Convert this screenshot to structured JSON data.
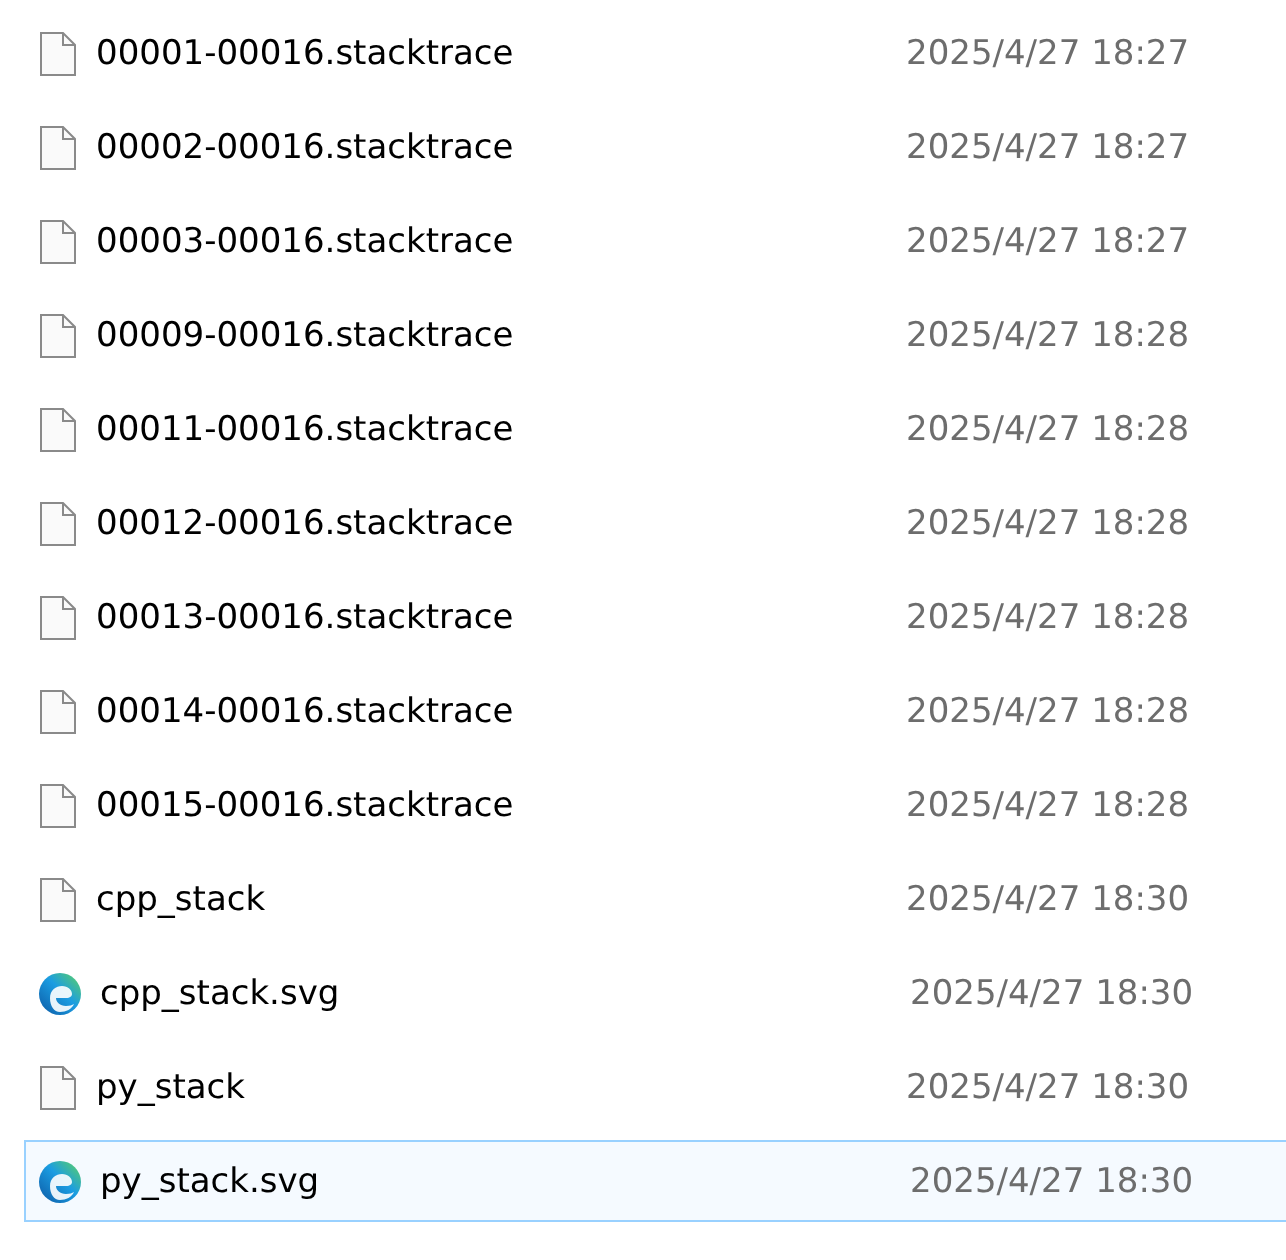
{
  "files": [
    {
      "name": "00001-00016.stacktrace",
      "date": "2025/4/27 18:27",
      "kind": "file",
      "selected": false
    },
    {
      "name": "00002-00016.stacktrace",
      "date": "2025/4/27 18:27",
      "kind": "file",
      "selected": false
    },
    {
      "name": "00003-00016.stacktrace",
      "date": "2025/4/27 18:27",
      "kind": "file",
      "selected": false
    },
    {
      "name": "00009-00016.stacktrace",
      "date": "2025/4/27 18:28",
      "kind": "file",
      "selected": false
    },
    {
      "name": "00011-00016.stacktrace",
      "date": "2025/4/27 18:28",
      "kind": "file",
      "selected": false
    },
    {
      "name": "00012-00016.stacktrace",
      "date": "2025/4/27 18:28",
      "kind": "file",
      "selected": false
    },
    {
      "name": "00013-00016.stacktrace",
      "date": "2025/4/27 18:28",
      "kind": "file",
      "selected": false
    },
    {
      "name": "00014-00016.stacktrace",
      "date": "2025/4/27 18:28",
      "kind": "file",
      "selected": false
    },
    {
      "name": "00015-00016.stacktrace",
      "date": "2025/4/27 18:28",
      "kind": "file",
      "selected": false
    },
    {
      "name": "cpp_stack",
      "date": "2025/4/27 18:30",
      "kind": "file",
      "selected": false
    },
    {
      "name": "cpp_stack.svg",
      "date": "2025/4/27 18:30",
      "kind": "browser",
      "selected": false
    },
    {
      "name": "py_stack",
      "date": "2025/4/27 18:30",
      "kind": "file",
      "selected": false
    },
    {
      "name": "py_stack.svg",
      "date": "2025/4/27 18:30",
      "kind": "browser",
      "selected": true
    }
  ]
}
